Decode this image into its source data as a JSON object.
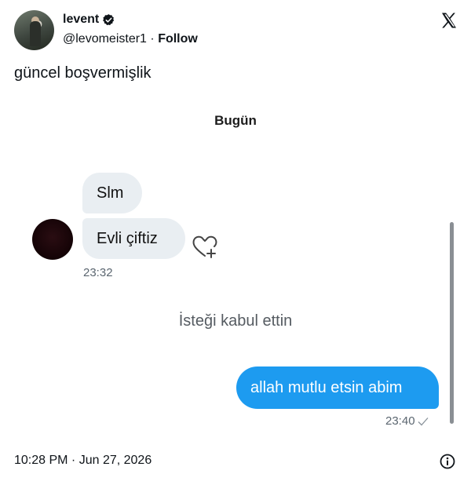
{
  "author": {
    "name": "levent",
    "handle": "@levomeister1",
    "separator": "·",
    "follow": "Follow"
  },
  "tweet": {
    "text": "güncel boşvermişlik",
    "timestamp": "10:28 PM · Jun 27, 2026"
  },
  "screenshot": {
    "day_label": "Bugün",
    "incoming": [
      "Slm",
      "Evli çiftiz"
    ],
    "incoming_time": "23:32",
    "system_note": "İsteği kabul ettin",
    "outgoing": "allah mutlu etsin abim",
    "outgoing_time": "23:40"
  },
  "colors": {
    "outgoing_bubble": "#1d9bf0",
    "incoming_bubble": "#e9eef2",
    "text": "#0f1419"
  },
  "icons": [
    "verified-badge-icon",
    "x-logo-icon",
    "heart-plus-icon",
    "checkmark-icon",
    "info-icon"
  ]
}
